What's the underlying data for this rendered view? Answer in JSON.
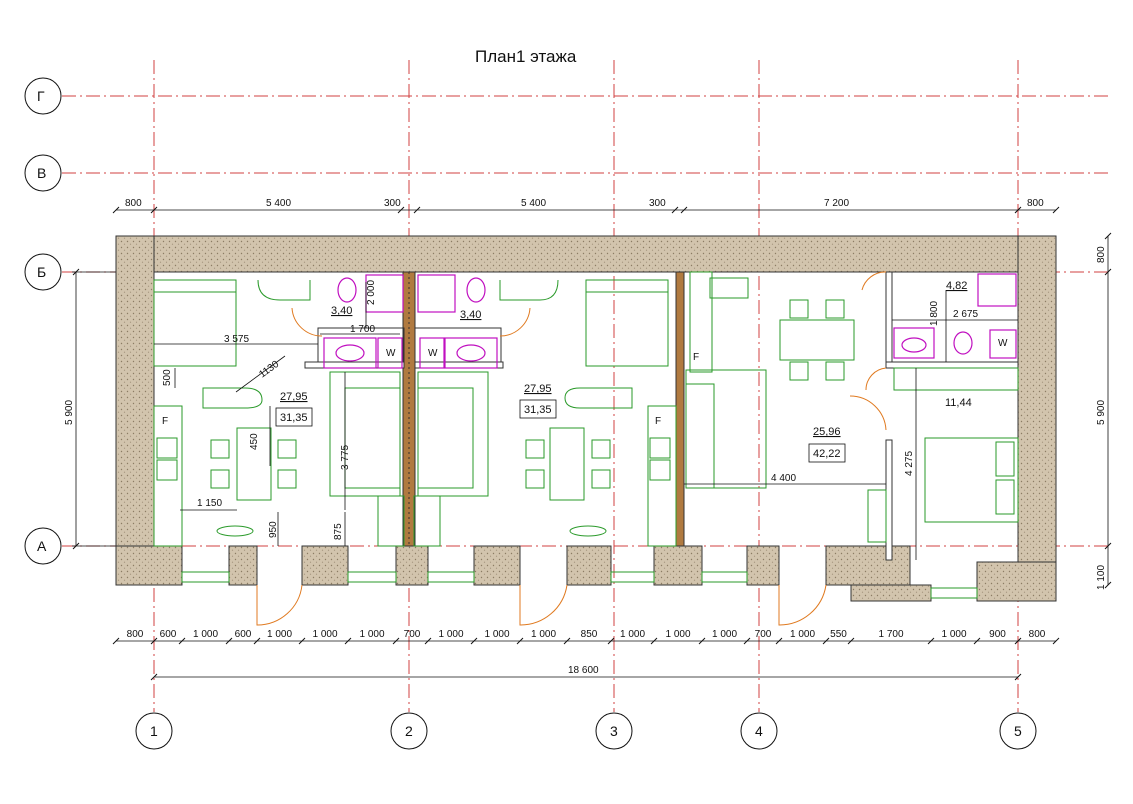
{
  "title": "План1 этажа",
  "axes_letters": [
    "Г",
    "В",
    "Б",
    "А"
  ],
  "axes_numbers": [
    "1",
    "2",
    "3",
    "4",
    "5"
  ],
  "top_dims": [
    "800",
    "5 400",
    "300",
    "5 400",
    "300",
    "7 200",
    "800"
  ],
  "bottom_dims": [
    "800",
    "600",
    "1 000",
    "600",
    "1 000",
    "1 000",
    "1 000",
    "700",
    "1 000",
    "1 000",
    "1 000",
    "850",
    "1 000",
    "1 000",
    "1 000",
    "700",
    "1 000",
    "550",
    "1 700",
    "1 000",
    "900",
    "800"
  ],
  "overall_dim": "18 600",
  "left_dim": "5 900",
  "right_dims": [
    "800",
    "5 900",
    "1 100"
  ],
  "inner_dims": {
    "d3575": "3 575",
    "d1130": "1130",
    "d500": "500",
    "d450": "450",
    "d1150": "1 150",
    "d950": "950",
    "d875": "875",
    "d3775": "3 775",
    "d2000": "2 000",
    "d1700": "1 700",
    "d4400": "4 400",
    "d1800": "1 800",
    "d2675": "2 675",
    "d4275": "4 275"
  },
  "areas": {
    "a1_living": "27,95",
    "a1_total": "31,35",
    "a1_bath": "3,40",
    "a2_bath": "3,40",
    "a2_living": "27,95",
    "a2_total": "31,35",
    "a3_living": "25,96",
    "a3_total": "42,22",
    "a3_bath": "4,82",
    "a3_bed": "11,44"
  },
  "appliance_marks": {
    "washer": "W",
    "fridge": "F"
  },
  "colors": {
    "axis_line": "#d04040",
    "furniture": "#2a9a2a",
    "sanitary": "#c010c0",
    "door": "#e07a20",
    "wall_fill": "#cdbfa8"
  }
}
